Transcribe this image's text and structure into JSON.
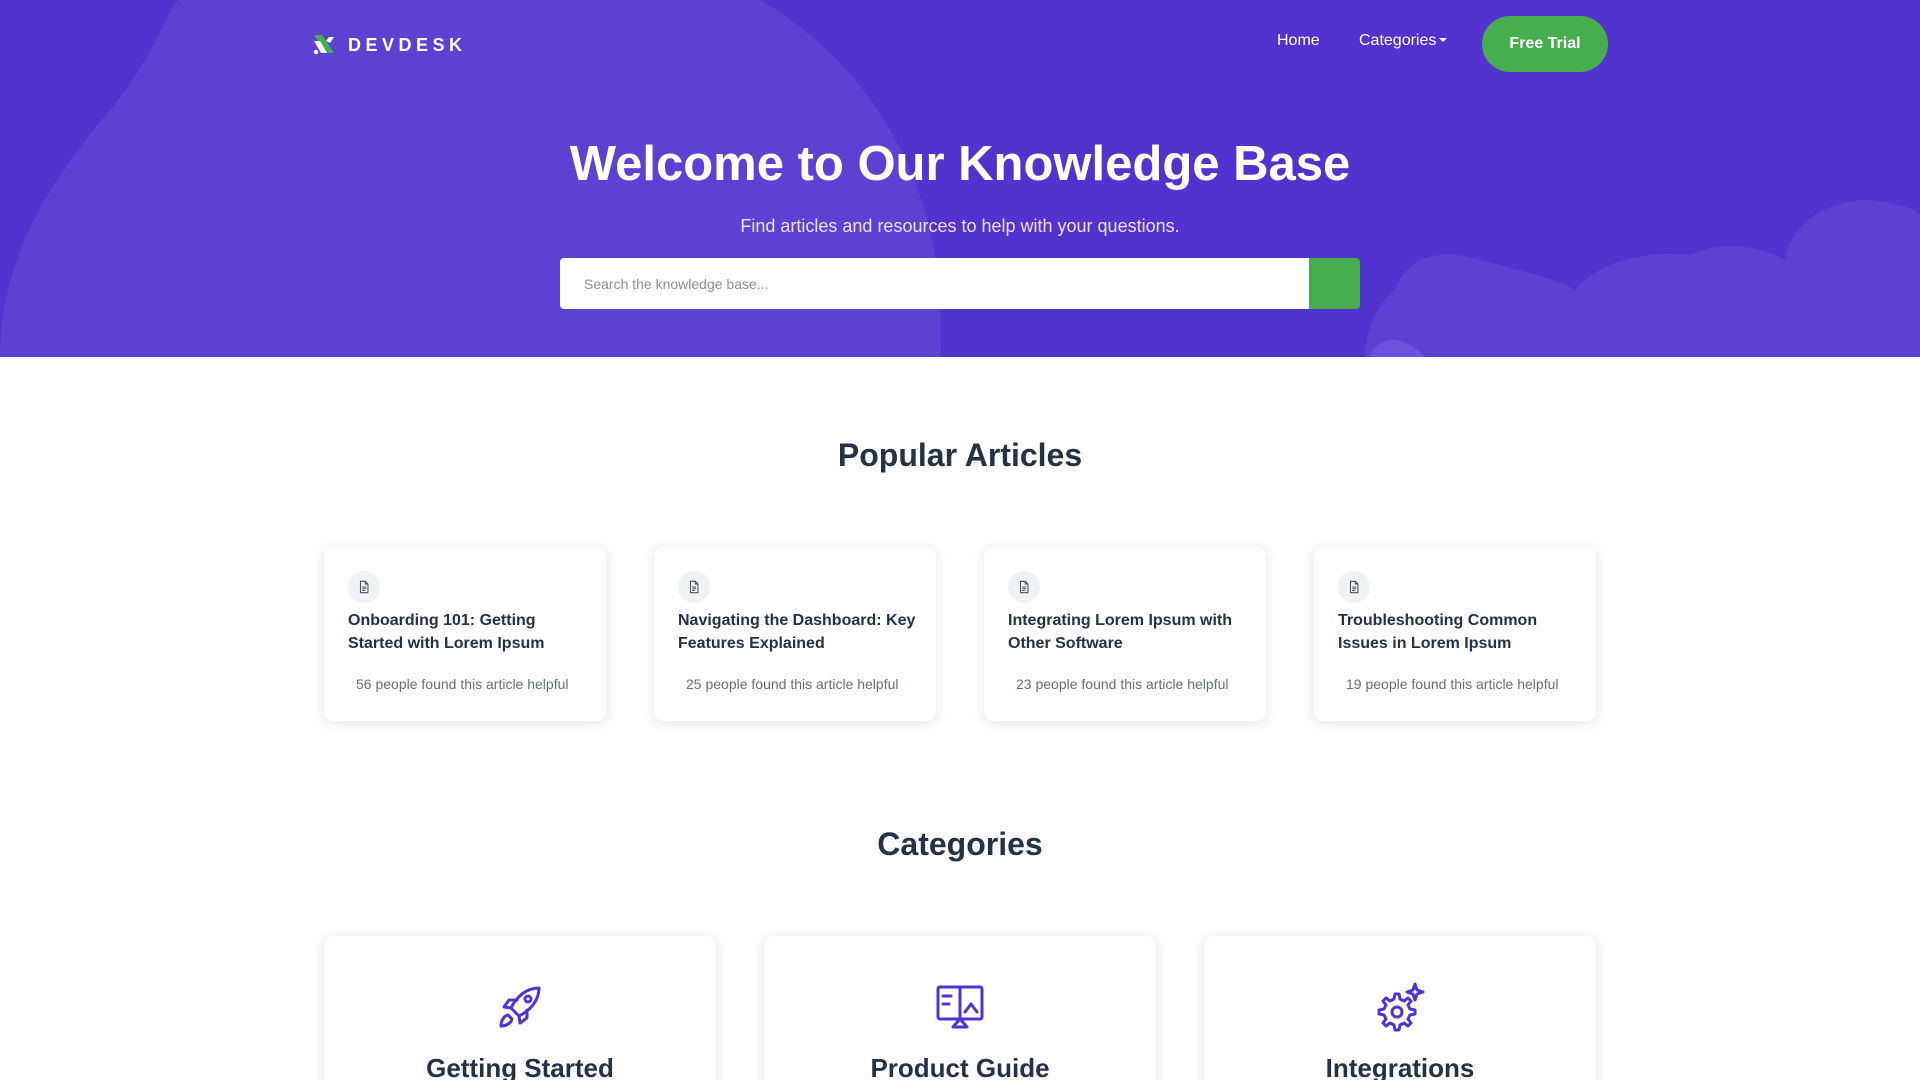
{
  "brand": {
    "name": "DEVDESK"
  },
  "nav": {
    "home_label": "Home",
    "categories_label": "Categories",
    "trial_label": "Free Trial"
  },
  "hero": {
    "title": "Welcome to Our Knowledge Base",
    "subtitle": "Find articles and resources to help with your questions.",
    "search_placeholder": "Search the knowledge base..."
  },
  "popular": {
    "title": "Popular Articles",
    "articles": [
      {
        "title": "Onboarding 101: Getting Started with Lorem Ipsum",
        "meta": "56 people found this article helpful",
        "icon": "document-icon"
      },
      {
        "title": "Navigating the Dashboard: Key Features Explained",
        "meta": "25 people found this article helpful",
        "icon": "document-icon"
      },
      {
        "title": "Integrating Lorem Ipsum with Other Software",
        "meta": "23 people found this article helpful",
        "icon": "document-icon"
      },
      {
        "title": "Troubleshooting Common Issues in Lorem Ipsum",
        "meta": "19 people found this article helpful",
        "icon": "document-icon"
      }
    ]
  },
  "categories": {
    "title": "Categories",
    "items": [
      {
        "title": "Getting Started",
        "icon": "rocket-icon"
      },
      {
        "title": "Product Guide",
        "icon": "monitor-icon"
      },
      {
        "title": "Integrations",
        "icon": "gear-sparkle-icon"
      }
    ]
  },
  "colors": {
    "hero_bg": "#5134cd",
    "accent_green": "#48ad4f",
    "icon_purple": "#5134cd",
    "heading_text": "#253243"
  }
}
